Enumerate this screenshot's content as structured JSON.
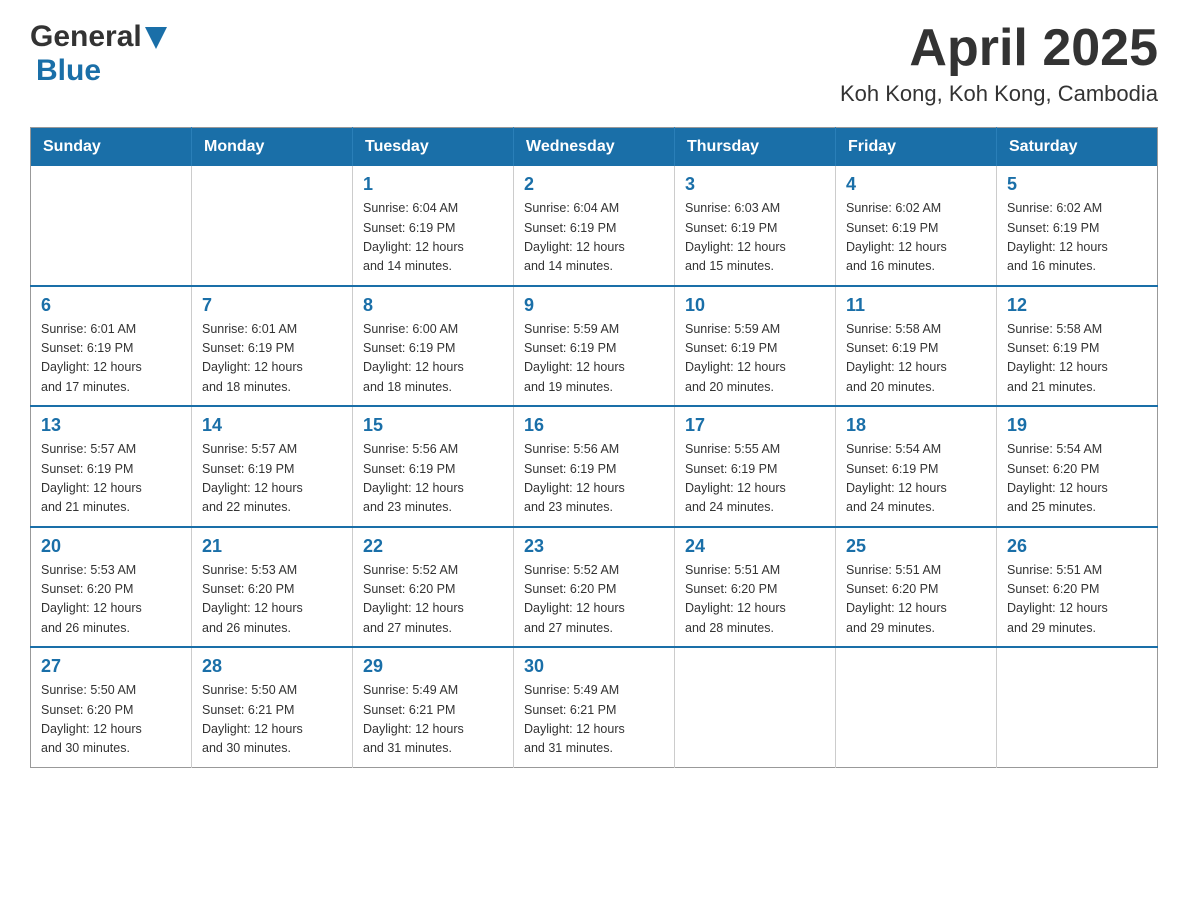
{
  "header": {
    "logo_general": "General",
    "logo_blue": "Blue",
    "title": "April 2025",
    "subtitle": "Koh Kong, Koh Kong, Cambodia"
  },
  "weekdays": [
    "Sunday",
    "Monday",
    "Tuesday",
    "Wednesday",
    "Thursday",
    "Friday",
    "Saturday"
  ],
  "weeks": [
    [
      {
        "day": "",
        "info": ""
      },
      {
        "day": "",
        "info": ""
      },
      {
        "day": "1",
        "info": "Sunrise: 6:04 AM\nSunset: 6:19 PM\nDaylight: 12 hours\nand 14 minutes."
      },
      {
        "day": "2",
        "info": "Sunrise: 6:04 AM\nSunset: 6:19 PM\nDaylight: 12 hours\nand 14 minutes."
      },
      {
        "day": "3",
        "info": "Sunrise: 6:03 AM\nSunset: 6:19 PM\nDaylight: 12 hours\nand 15 minutes."
      },
      {
        "day": "4",
        "info": "Sunrise: 6:02 AM\nSunset: 6:19 PM\nDaylight: 12 hours\nand 16 minutes."
      },
      {
        "day": "5",
        "info": "Sunrise: 6:02 AM\nSunset: 6:19 PM\nDaylight: 12 hours\nand 16 minutes."
      }
    ],
    [
      {
        "day": "6",
        "info": "Sunrise: 6:01 AM\nSunset: 6:19 PM\nDaylight: 12 hours\nand 17 minutes."
      },
      {
        "day": "7",
        "info": "Sunrise: 6:01 AM\nSunset: 6:19 PM\nDaylight: 12 hours\nand 18 minutes."
      },
      {
        "day": "8",
        "info": "Sunrise: 6:00 AM\nSunset: 6:19 PM\nDaylight: 12 hours\nand 18 minutes."
      },
      {
        "day": "9",
        "info": "Sunrise: 5:59 AM\nSunset: 6:19 PM\nDaylight: 12 hours\nand 19 minutes."
      },
      {
        "day": "10",
        "info": "Sunrise: 5:59 AM\nSunset: 6:19 PM\nDaylight: 12 hours\nand 20 minutes."
      },
      {
        "day": "11",
        "info": "Sunrise: 5:58 AM\nSunset: 6:19 PM\nDaylight: 12 hours\nand 20 minutes."
      },
      {
        "day": "12",
        "info": "Sunrise: 5:58 AM\nSunset: 6:19 PM\nDaylight: 12 hours\nand 21 minutes."
      }
    ],
    [
      {
        "day": "13",
        "info": "Sunrise: 5:57 AM\nSunset: 6:19 PM\nDaylight: 12 hours\nand 21 minutes."
      },
      {
        "day": "14",
        "info": "Sunrise: 5:57 AM\nSunset: 6:19 PM\nDaylight: 12 hours\nand 22 minutes."
      },
      {
        "day": "15",
        "info": "Sunrise: 5:56 AM\nSunset: 6:19 PM\nDaylight: 12 hours\nand 23 minutes."
      },
      {
        "day": "16",
        "info": "Sunrise: 5:56 AM\nSunset: 6:19 PM\nDaylight: 12 hours\nand 23 minutes."
      },
      {
        "day": "17",
        "info": "Sunrise: 5:55 AM\nSunset: 6:19 PM\nDaylight: 12 hours\nand 24 minutes."
      },
      {
        "day": "18",
        "info": "Sunrise: 5:54 AM\nSunset: 6:19 PM\nDaylight: 12 hours\nand 24 minutes."
      },
      {
        "day": "19",
        "info": "Sunrise: 5:54 AM\nSunset: 6:20 PM\nDaylight: 12 hours\nand 25 minutes."
      }
    ],
    [
      {
        "day": "20",
        "info": "Sunrise: 5:53 AM\nSunset: 6:20 PM\nDaylight: 12 hours\nand 26 minutes."
      },
      {
        "day": "21",
        "info": "Sunrise: 5:53 AM\nSunset: 6:20 PM\nDaylight: 12 hours\nand 26 minutes."
      },
      {
        "day": "22",
        "info": "Sunrise: 5:52 AM\nSunset: 6:20 PM\nDaylight: 12 hours\nand 27 minutes."
      },
      {
        "day": "23",
        "info": "Sunrise: 5:52 AM\nSunset: 6:20 PM\nDaylight: 12 hours\nand 27 minutes."
      },
      {
        "day": "24",
        "info": "Sunrise: 5:51 AM\nSunset: 6:20 PM\nDaylight: 12 hours\nand 28 minutes."
      },
      {
        "day": "25",
        "info": "Sunrise: 5:51 AM\nSunset: 6:20 PM\nDaylight: 12 hours\nand 29 minutes."
      },
      {
        "day": "26",
        "info": "Sunrise: 5:51 AM\nSunset: 6:20 PM\nDaylight: 12 hours\nand 29 minutes."
      }
    ],
    [
      {
        "day": "27",
        "info": "Sunrise: 5:50 AM\nSunset: 6:20 PM\nDaylight: 12 hours\nand 30 minutes."
      },
      {
        "day": "28",
        "info": "Sunrise: 5:50 AM\nSunset: 6:21 PM\nDaylight: 12 hours\nand 30 minutes."
      },
      {
        "day": "29",
        "info": "Sunrise: 5:49 AM\nSunset: 6:21 PM\nDaylight: 12 hours\nand 31 minutes."
      },
      {
        "day": "30",
        "info": "Sunrise: 5:49 AM\nSunset: 6:21 PM\nDaylight: 12 hours\nand 31 minutes."
      },
      {
        "day": "",
        "info": ""
      },
      {
        "day": "",
        "info": ""
      },
      {
        "day": "",
        "info": ""
      }
    ]
  ]
}
